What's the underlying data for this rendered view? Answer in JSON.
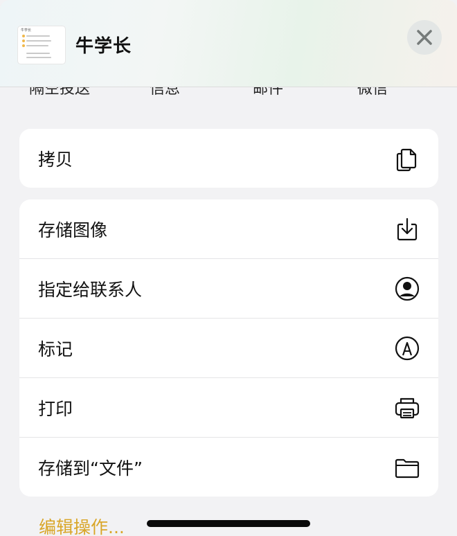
{
  "header": {
    "title": "牛学长",
    "thumbnail_label": "牛学长",
    "close_icon": "close-icon"
  },
  "share_targets": [
    "隔空投送",
    "信息",
    "邮件",
    "微信"
  ],
  "copy_section": {
    "label": "拷贝",
    "icon": "copy-icon"
  },
  "actions": [
    {
      "label": "存储图像",
      "icon": "save-image-icon"
    },
    {
      "label": "指定给联系人",
      "icon": "contact-icon"
    },
    {
      "label": "标记",
      "icon": "markup-icon"
    },
    {
      "label": "打印",
      "icon": "printer-icon"
    },
    {
      "label": "存储到“文件”",
      "icon": "folder-icon"
    }
  ],
  "edit_actions_label": "编辑操作...",
  "colors": {
    "background": "#f2f2f4",
    "card": "#ffffff",
    "accent": "#d9a629"
  }
}
